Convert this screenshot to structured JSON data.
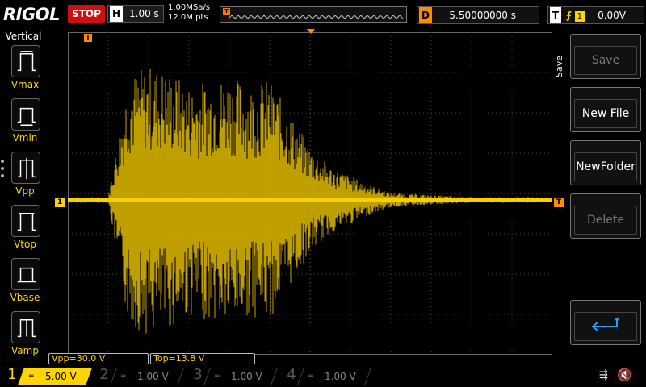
{
  "top_bar": {
    "brand": "RIGOL",
    "run_state": "STOP",
    "timebase_label": "H",
    "timebase_value": "1.00 s",
    "sample_rate": "1.00MSa/s",
    "memory_depth": "12.0M pts",
    "memory_trigger_label": "T",
    "delay_label": "D",
    "delay_value": "5.50000000 s",
    "trigger_label": "T",
    "trigger_edge": "⨍",
    "trigger_source": "1",
    "trigger_level": "0.00V"
  },
  "left_panel": {
    "title": "Vertical",
    "items": [
      {
        "label": "Vmax",
        "icon": "vmax-icon"
      },
      {
        "label": "Vmin",
        "icon": "vmin-icon"
      },
      {
        "label": "Vpp",
        "icon": "vpp-icon"
      },
      {
        "label": "Vtop",
        "icon": "vtop-icon"
      },
      {
        "label": "Vbase",
        "icon": "vbase-icon"
      },
      {
        "label": "Vamp",
        "icon": "vamp-icon"
      }
    ]
  },
  "right_panel": {
    "title": "Save",
    "buttons": [
      {
        "label": "Save",
        "enabled": false
      },
      {
        "label": "New File",
        "enabled": true
      },
      {
        "label": "NewFolder",
        "enabled": true
      },
      {
        "label": "Delete",
        "enabled": false
      }
    ],
    "return_icon": "return-arrow-icon"
  },
  "markers": {
    "ch1": "1",
    "trigger_top": "T",
    "trigger_level": "T"
  },
  "readouts": {
    "vpp": "Vpp=30.0 V",
    "top": "Top=13.8 V"
  },
  "channels": [
    {
      "num": "1",
      "scale": "5.00 V",
      "color": "#ffd400",
      "active": true
    },
    {
      "num": "2",
      "scale": "1.00 V",
      "color": "#00c0c0",
      "active": false
    },
    {
      "num": "3",
      "scale": "1.00 V",
      "color": "#c000c0",
      "active": false
    },
    {
      "num": "4",
      "scale": "1.00 V",
      "color": "#2060ff",
      "active": false
    }
  ],
  "status": {
    "usb_icon": "usb-icon",
    "sound_icon": "mute-icon",
    "usb_glyph": "⇶",
    "sound_glyph": "🔇"
  },
  "colors": {
    "ch1": "#ffd400",
    "trigger": "#ff8c00",
    "stop": "#d01010"
  },
  "chart_data": {
    "type": "line",
    "title": "",
    "xlabel": "",
    "ylabel": "",
    "grid": true,
    "x_divisions": 12,
    "y_divisions": 8,
    "series": [
      {
        "values_time_s": [
          0.5,
          1.0,
          1.5,
          2.0,
          2.5,
          3.0,
          3.5,
          4.0,
          4.5,
          5.0,
          5.5,
          6.0,
          6.5,
          7.0,
          7.5,
          8.0,
          8.5,
          9.0,
          9.5,
          10.0,
          10.5,
          11.0,
          11.5,
          12.0
        ],
        "envelope_v": [
          0.3,
          0.3,
          13.0,
          14.0,
          13.5,
          12.0,
          12.5,
          13.0,
          12.0,
          12.5,
          9.0,
          5.5,
          3.5,
          2.5,
          1.5,
          0.8,
          0.6,
          0.5,
          0.4,
          0.3,
          0.3,
          0.3,
          0.3,
          0.3
        ]
      }
    ]
  }
}
